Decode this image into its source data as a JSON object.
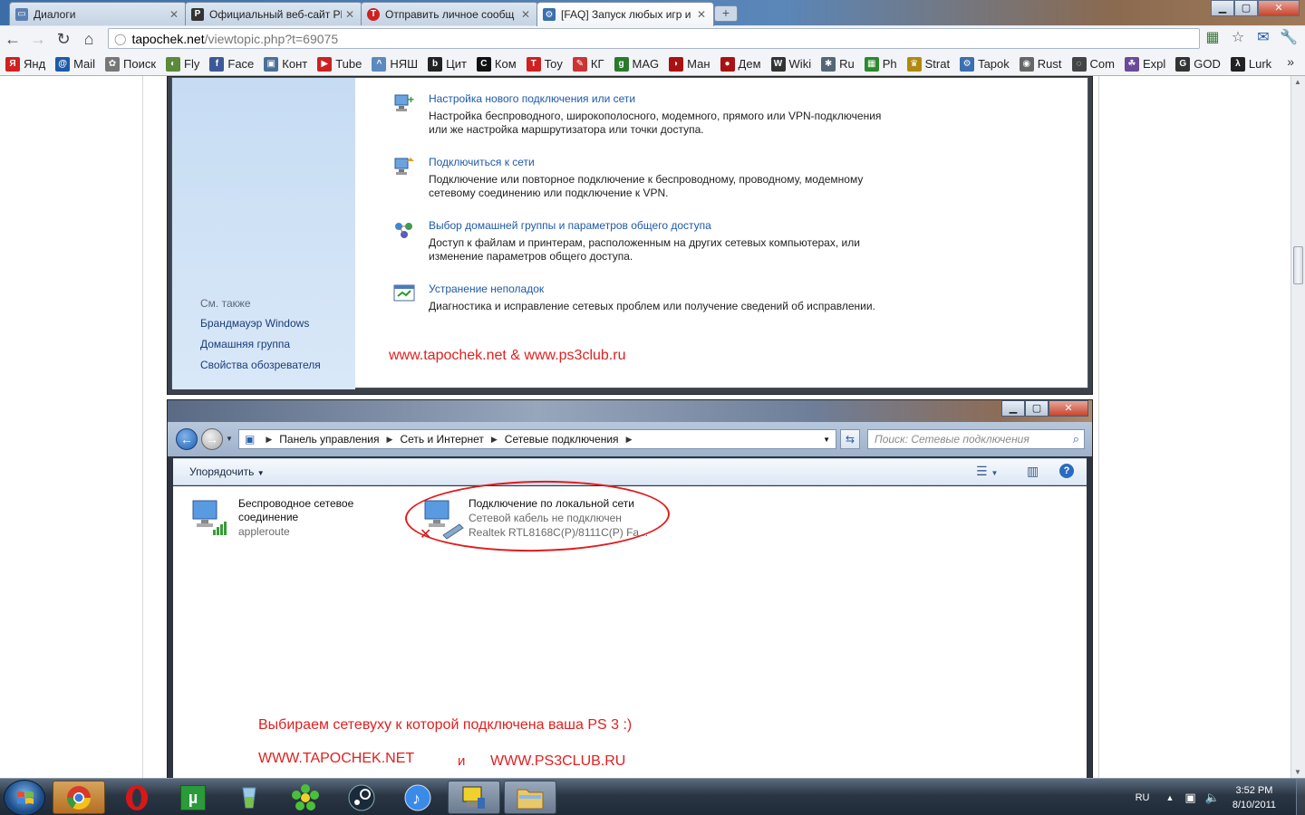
{
  "browser": {
    "tabs": [
      {
        "label": "Диалоги",
        "icon": "dialogs-icon",
        "color": "#5a7fb5"
      },
      {
        "label": "Официальный веб-сайт Pl",
        "icon": "playstation-icon",
        "color": "#333333"
      },
      {
        "label": "Отправить личное сообщ",
        "icon": "tapochek-icon",
        "color": "#d02020"
      },
      {
        "label": "[FAQ] Запуск любых игр и",
        "icon": "gear-icon",
        "color": "#3a6fb0"
      }
    ],
    "url_host": "tapochek.net",
    "url_path": "/viewtopic.php?t=69075",
    "bookmarks": [
      {
        "label": "Янд",
        "color": "#d02020",
        "glyph": "Я"
      },
      {
        "label": "Mail",
        "color": "#1e5aa8",
        "glyph": "@"
      },
      {
        "label": "Поиск",
        "color": "#777777",
        "glyph": "✿"
      },
      {
        "label": "Fly",
        "color": "#5a8a3a",
        "glyph": "◐"
      },
      {
        "label": "Face",
        "color": "#3b5998",
        "glyph": "f"
      },
      {
        "label": "Конт",
        "color": "#4a6e9a",
        "glyph": "▣"
      },
      {
        "label": "Tube",
        "color": "#cc2222",
        "glyph": "▶"
      },
      {
        "label": "НЯШ",
        "color": "#5a8ac0",
        "glyph": "^"
      },
      {
        "label": "Цит",
        "color": "#222222",
        "glyph": "b"
      },
      {
        "label": "Ком",
        "color": "#111111",
        "glyph": "C"
      },
      {
        "label": "Toy",
        "color": "#d02020",
        "glyph": "T"
      },
      {
        "label": "КГ",
        "color": "#cc3333",
        "glyph": "✎"
      },
      {
        "label": "MAG",
        "color": "#2a7a2a",
        "glyph": "g"
      },
      {
        "label": "Ман",
        "color": "#aa1111",
        "glyph": "◗"
      },
      {
        "label": "Дем",
        "color": "#aa1111",
        "glyph": "●"
      },
      {
        "label": "Wiki",
        "color": "#333333",
        "glyph": "W"
      },
      {
        "label": "Ru",
        "color": "#556677",
        "glyph": "✱"
      },
      {
        "label": "Ph",
        "color": "#2a8a2a",
        "glyph": "▦"
      },
      {
        "label": "Strat",
        "color": "#b08a10",
        "glyph": "♛"
      },
      {
        "label": "Tapok",
        "color": "#3a6fb0",
        "glyph": "⚙"
      },
      {
        "label": "Rust",
        "color": "#666666",
        "glyph": "◉"
      },
      {
        "label": "Com",
        "color": "#444444",
        "glyph": "◌"
      },
      {
        "label": "Expl",
        "color": "#6a4a9a",
        "glyph": "☘"
      },
      {
        "label": "GOD",
        "color": "#333333",
        "glyph": "G"
      },
      {
        "label": "Lurk",
        "color": "#222222",
        "glyph": "λ"
      }
    ]
  },
  "shot1": {
    "see_also": "См. также",
    "links": [
      "Брандмауэр Windows",
      "Домашняя группа",
      "Свойства обозревателя"
    ],
    "tasks": [
      {
        "title": "Настройка нового подключения или сети",
        "desc": "Настройка беспроводного, широкополосного, модемного, прямого или VPN-подключения",
        "desc2": "или же настройка маршрутизатора или точки доступа."
      },
      {
        "title": "Подключиться к сети",
        "desc": "Подключение или повторное подключение к беспроводному, проводному, модемному",
        "desc2": "сетевому соединению или подключение к VPN."
      },
      {
        "title": "Выбор домашней группы и параметров общего доступа",
        "desc": "Доступ к файлам и принтерам, расположенным на других сетевых компьютерах, или",
        "desc2": "изменение параметров общего доступа."
      },
      {
        "title": "Устранение неполадок",
        "desc": "Диагностика и исправление сетевых проблем или получение сведений об исправлении.",
        "desc2": ""
      }
    ],
    "watermark": "www.tapochek.net & www.ps3club.ru"
  },
  "shot2": {
    "breadcrumb": [
      "Панель управления",
      "Сеть и Интернет",
      "Сетевые подключения"
    ],
    "search_placeholder": "Поиск: Сетевые подключения",
    "organize": "Упорядочить",
    "items": [
      {
        "name1": "Беспроводное сетевое",
        "name2": "соединение",
        "sub1": "appleroute",
        "sub2": ""
      },
      {
        "name1": "Подключение по локальной сети",
        "name2": "",
        "sub1": "Сетевой кабель не подключен",
        "sub2": "Realtek RTL8168C(P)/8111C(P) Fa..."
      }
    ],
    "caption": "Выбираем сетевуху к которой подключена ваша PS 3 :)",
    "wm_left": "WWW.TAPOCHEK.NET",
    "wm_and": "и",
    "wm_right": "WWW.PS3CLUB.RU"
  },
  "taskbar": {
    "lang": "RU",
    "time": "3:52 PM",
    "date": "8/10/2011"
  },
  "colors": {
    "accent_red": "#e02020",
    "link_blue": "#1e5aa8"
  }
}
